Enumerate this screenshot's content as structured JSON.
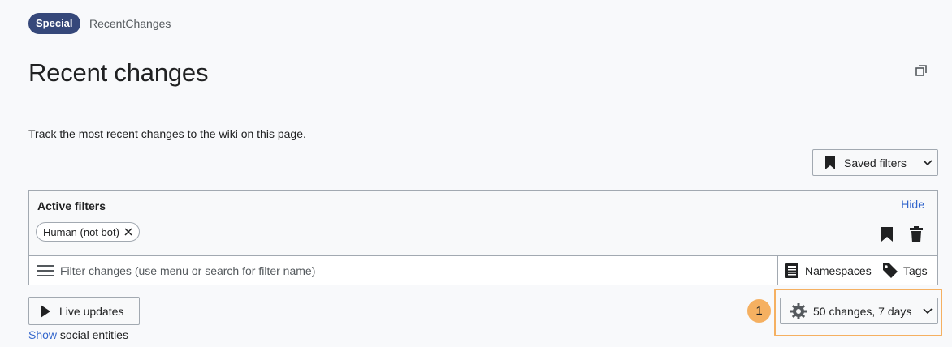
{
  "breadcrumb": {
    "namespace": "Special",
    "page": "RecentChanges"
  },
  "title": "Recent changes",
  "intro": "Track the most recent changes to the wiki on this page.",
  "saved_filters": {
    "label": "Saved filters",
    "icon": "bookmark-icon"
  },
  "active_filters": {
    "label": "Active filters",
    "hide_label": "Hide",
    "chips": [
      {
        "label": "Human (not bot)"
      }
    ]
  },
  "search": {
    "placeholder": "Filter changes (use menu or search for filter name)",
    "value": "",
    "namespaces_label": "Namespaces",
    "tags_label": "Tags"
  },
  "live_updates": {
    "label": "Live updates"
  },
  "show_line": {
    "link": "Show",
    "text": " social entities"
  },
  "results_options": {
    "label": "50 changes, 7 days"
  },
  "annotation": {
    "step": "1",
    "color": "#f5b061"
  },
  "colors": {
    "accent": "#36487a",
    "link": "#3366cc",
    "border": "#a2a9b1"
  }
}
